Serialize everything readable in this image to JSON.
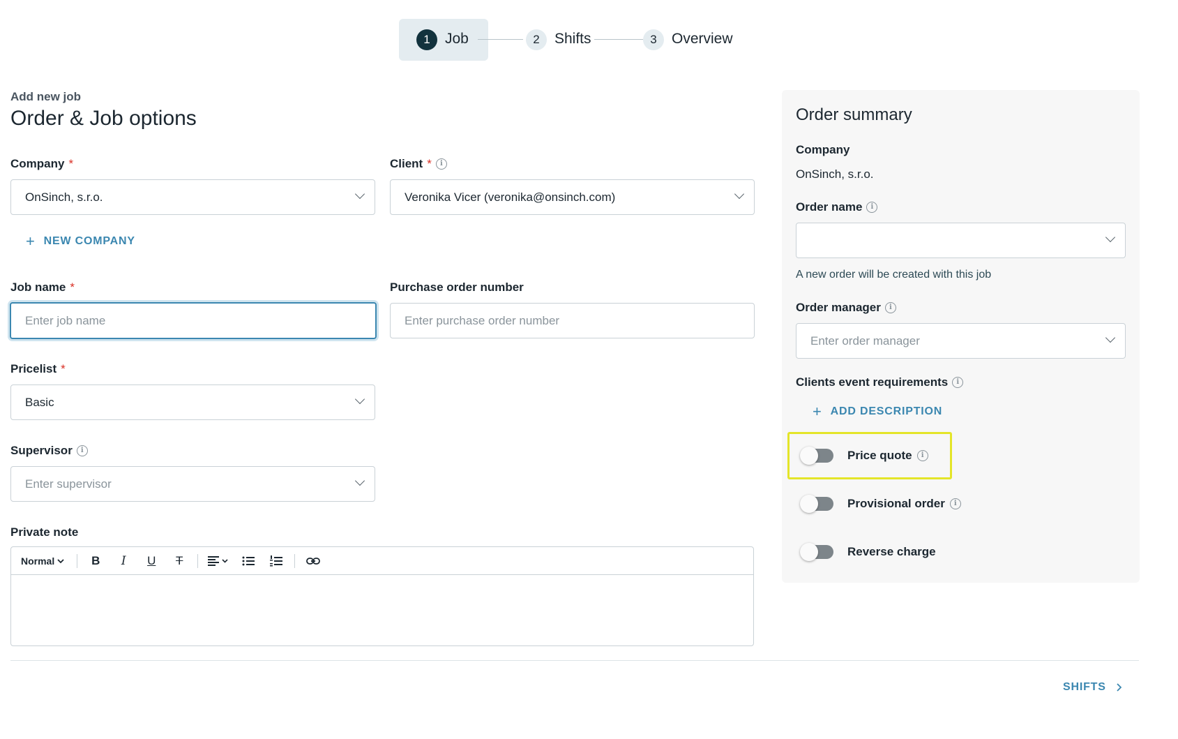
{
  "stepper": {
    "steps": [
      {
        "num": "1",
        "label": "Job"
      },
      {
        "num": "2",
        "label": "Shifts"
      },
      {
        "num": "3",
        "label": "Overview"
      }
    ]
  },
  "header": {
    "subtitle": "Add new job",
    "title": "Order & Job options"
  },
  "form": {
    "company": {
      "label": "Company",
      "required": "*",
      "value": "OnSinch, s.r.o."
    },
    "client": {
      "label": "Client",
      "required": "*",
      "value": "Veronika Vicer (veronika@onsinch.com)"
    },
    "new_company": {
      "label": "NEW COMPANY"
    },
    "job_name": {
      "label": "Job name",
      "required": "*",
      "placeholder": "Enter job name"
    },
    "purchase_order": {
      "label": "Purchase order number",
      "placeholder": "Enter purchase order number"
    },
    "pricelist": {
      "label": "Pricelist",
      "required": "*",
      "value": "Basic"
    },
    "supervisor": {
      "label": "Supervisor",
      "placeholder": "Enter supervisor"
    },
    "private_note": {
      "label": "Private note",
      "format": "Normal"
    }
  },
  "summary": {
    "title": "Order summary",
    "company_label": "Company",
    "company_value": "OnSinch, s.r.o.",
    "order_name_label": "Order name",
    "order_name_hint": "A new order will be created with this job",
    "order_manager_label": "Order manager",
    "order_manager_placeholder": "Enter order manager",
    "requirements_label": "Clients event requirements",
    "add_description": "ADD DESCRIPTION",
    "toggles": [
      {
        "label": "Price quote",
        "on": false
      },
      {
        "label": "Provisional order",
        "on": false
      },
      {
        "label": "Reverse charge",
        "on": false
      }
    ]
  },
  "footer": {
    "next_label": "SHIFTS"
  },
  "colors": {
    "accent": "#3b87b0",
    "required": "#d93025",
    "highlight": "#e4e529",
    "step_active": "#12323d"
  },
  "icons": [
    "chevron-down-icon",
    "info-icon",
    "plus-icon",
    "bold-icon",
    "italic-icon",
    "underline-icon",
    "strikethrough-icon",
    "align-icon",
    "bullet-list-icon",
    "ordered-list-icon",
    "link-icon",
    "chevron-right-icon"
  ]
}
